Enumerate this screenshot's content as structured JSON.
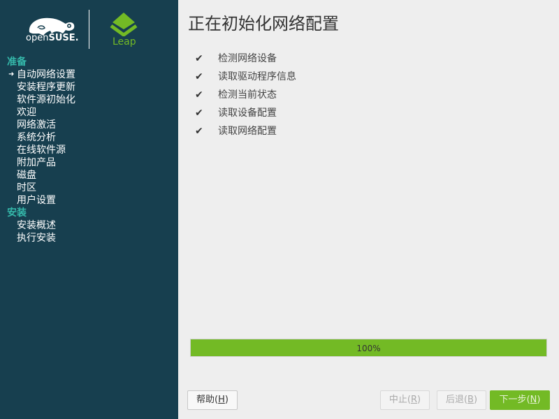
{
  "sidebar": {
    "logo_suse_prefix": "open",
    "logo_suse_suffix": "SUSE.",
    "logo_leap": "Leap",
    "sections": [
      {
        "title": "准备",
        "items": [
          {
            "label": "自动网络设置",
            "current": true
          },
          {
            "label": "安装程序更新"
          },
          {
            "label": "软件源初始化"
          },
          {
            "label": "欢迎"
          },
          {
            "label": "网络激活"
          },
          {
            "label": "系统分析"
          },
          {
            "label": "在线软件源"
          },
          {
            "label": "附加产品"
          },
          {
            "label": "磁盘"
          },
          {
            "label": "时区"
          },
          {
            "label": "用户设置"
          }
        ]
      },
      {
        "title": "安装",
        "items": [
          {
            "label": "安装概述"
          },
          {
            "label": "执行安装"
          }
        ]
      }
    ],
    "current_arrow": "➜"
  },
  "main": {
    "title": "正在初始化网络配置",
    "check_glyph": "✔",
    "tasks": [
      "检测网络设备",
      "读取驱动程序信息",
      "检测当前状态",
      "读取设备配置",
      "读取网络配置"
    ],
    "progress_value": 1.0,
    "progress_label": "100%"
  },
  "buttons": {
    "help": {
      "label": "帮助",
      "key": "H"
    },
    "abort": {
      "label": "中止",
      "key": "R"
    },
    "back": {
      "label": "后退",
      "key": "B"
    },
    "next": {
      "label": "下一步",
      "key": "N"
    }
  },
  "colors": {
    "sidebar_bg": "#173f4f",
    "section_title": "#35b9ab",
    "accent_green": "#73ba25"
  }
}
